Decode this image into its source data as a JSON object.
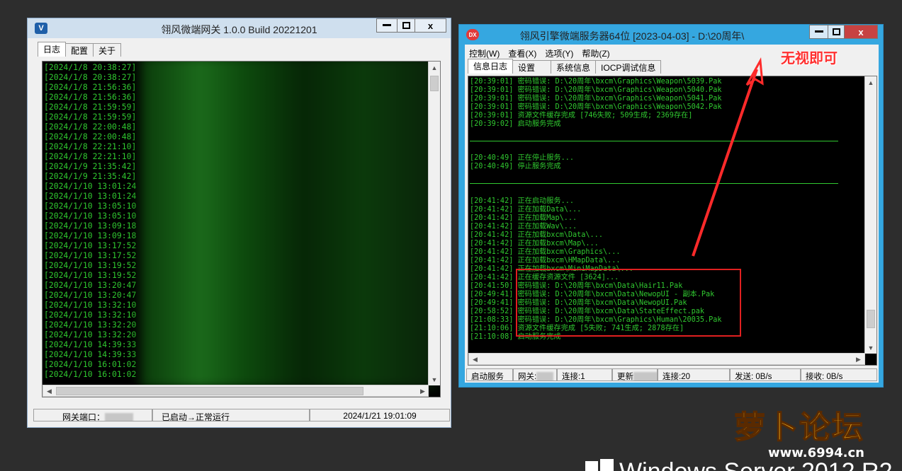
{
  "left_window": {
    "title": "翎风微端网关 1.0.0 Build 20221201",
    "icon_letter": "V",
    "controls": {
      "minimize": "▬",
      "maximize": "□",
      "close": "x"
    },
    "tabs": [
      "日志",
      "配置",
      "关于"
    ],
    "log_lines": [
      "[2024/1/8 20:38:27]",
      "[2024/1/8 20:38:27]",
      "[2024/1/8 21:56:36]",
      "[2024/1/8 21:56:36]",
      "[2024/1/8 21:59:59]",
      "[2024/1/8 21:59:59]",
      "[2024/1/8 22:00:48]",
      "[2024/1/8 22:00:48]",
      "[2024/1/8 22:21:10]",
      "[2024/1/8 22:21:10]",
      "[2024/1/9 21:35:42]",
      "[2024/1/9 21:35:42]",
      "[2024/1/10 13:01:24",
      "[2024/1/10 13:01:24",
      "[2024/1/10 13:05:10",
      "[2024/1/10 13:05:10",
      "[2024/1/10 13:09:18",
      "[2024/1/10 13:09:18",
      "[2024/1/10 13:17:52",
      "[2024/1/10 13:17:52",
      "[2024/1/10 13:19:52",
      "[2024/1/10 13:19:52",
      "[2024/1/10 13:20:47",
      "[2024/1/10 13:20:47",
      "[2024/1/10 13:32:10",
      "[2024/1/10 13:32:10",
      "[2024/1/10 13:32:20",
      "[2024/1/10 13:32:20",
      "[2024/1/10 14:39:33",
      "[2024/1/10 14:39:33",
      "[2024/1/10 16:01:02",
      "[2024/1/10 16:01:02"
    ],
    "status": {
      "port_label": "网关端口：",
      "state": "已启动→正常运行",
      "datetime": "2024/1/21 19:01:09"
    }
  },
  "right_window": {
    "title": "翎风引擎微端服务器64位 [2023-04-03] - D:\\20周年\\",
    "icon_letter": "DX",
    "controls": {
      "minimize": "▬",
      "maximize": "□",
      "close": "x"
    },
    "menu": [
      "控制(W)",
      "查看(X)",
      "选项(Y)",
      "帮助(Z)"
    ],
    "tabs": [
      "信息日志",
      "设置",
      "系统信息",
      "IOCP调试信息"
    ],
    "log_block_1": [
      "[20:39:01] 密码错误: D:\\20周年\\bxcm\\Graphics\\Weapon\\5039.Pak",
      "[20:39:01] 密码错误: D:\\20周年\\bxcm\\Graphics\\Weapon\\5040.Pak",
      "[20:39:01] 密码错误: D:\\20周年\\bxcm\\Graphics\\Weapon\\5041.Pak",
      "[20:39:01] 密码错误: D:\\20周年\\bxcm\\Graphics\\Weapon\\5042.Pak",
      "[20:39:01] 资源文件缓存完成 [746失败; 509生成; 2369存在]",
      "[20:39:02] 启动服务完成"
    ],
    "log_block_2": [
      "[20:40:49] 正在停止服务...",
      "[20:40:49] 停止服务完成"
    ],
    "log_block_3": [
      "[20:41:42] 正在启动服务...",
      "[20:41:42] 正在加载Data\\...",
      "[20:41:42] 正在加载Map\\...",
      "[20:41:42] 正在加载Wav\\...",
      "[20:41:42] 正在加载bxcm\\Data\\...",
      "[20:41:42] 正在加载bxcm\\Map\\...",
      "[20:41:42] 正在加载bxcm\\Graphics\\...",
      "[20:41:42] 正在加载bxcm\\HMapData\\...",
      "[20:41:42] 正在加载bxcm\\MiniMapData\\...",
      "[20:41:42] 正在缓存资源文件 [3624]...",
      "[20:41:50] 密码错误: D:\\20周年\\bxcm\\Data\\Hair11.Pak",
      "[20:49:41] 密码错误: D:\\20周年\\bxcm\\Data\\NewopUI - 副本.Pak",
      "[20:49:41] 密码错误: D:\\20周年\\bxcm\\Data\\NewopUI.Pak",
      "[20:58:52] 密码错误: D:\\20周年\\bxcm\\Data\\StateEffect.pak",
      "[21:08:33] 密码错误: D:\\20周年\\bxcm\\Graphics\\Human\\20035.Pak",
      "[21:10:06] 资源文件缓存完成 [5失败; 741生成; 2878存在]",
      "[21:10:08] 启动服务完成"
    ],
    "status": {
      "start": "启动服务",
      "gateway": "网关:",
      "conn1": "连接:1",
      "update": "更新",
      "conn2": "连接:20",
      "send": "发送: 0B/s",
      "recv": "接收: 0B/s"
    }
  },
  "annotation": "无视即可",
  "watermark": {
    "title": "萝卜论坛",
    "url": "www.6994.cn"
  },
  "os_logo": "Windows Server 2012 R2",
  "colors": {
    "log_green": "#30c830",
    "annotation_red": "#ff3030",
    "titlebar_blue": "#35a7e0"
  }
}
